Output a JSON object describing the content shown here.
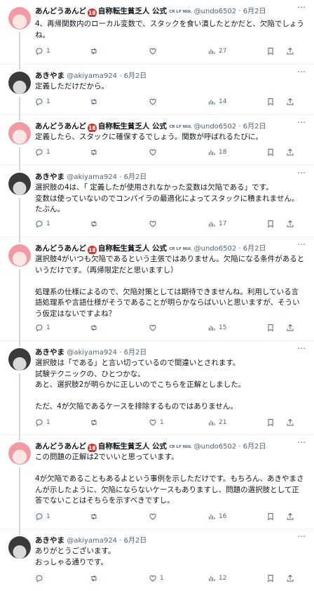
{
  "tweets": [
    {
      "avatar": "pink",
      "name": "あんどうあんど",
      "badge": "18",
      "name_suffix": "自称転生貧乏人 公式",
      "tiny_tag": "CR LF NUL",
      "handle_date": "@undo6502 · 6月2日",
      "text": "4、再帰関数内のローカル変数で、スタックを食い潰したとかだと、欠陥でしょうね。",
      "reply": "1",
      "retweet": "",
      "like": "",
      "views": "27"
    },
    {
      "avatar": "gray",
      "name": "あきやま",
      "name_suffix": "",
      "tiny_tag": "",
      "handle_date": "@akiyama924 · 6月2日",
      "text": "定義しただけだから。",
      "reply": "1",
      "retweet": "",
      "like": "",
      "views": "14"
    },
    {
      "avatar": "pink",
      "name": "あんどうあんど",
      "badge": "18",
      "name_suffix": "自称転生貧乏人 公式",
      "tiny_tag": "CR LF NUL",
      "handle_date": "@undo6502 · 6月2日",
      "text": "定義したら、スタックに確保するでしょう。関数が呼ばれるたびに。",
      "reply": "1",
      "retweet": "",
      "like": "",
      "views": "18"
    },
    {
      "avatar": "gray",
      "name": "あきやま",
      "name_suffix": "",
      "tiny_tag": "",
      "handle_date": "@akiyama924 · 6月2日",
      "text": "選択肢の4は、「 定義したが使用されなかった変数は欠陥である」です。\n変数は使っていないのでコンパイラの最適化によってスタックに積まれません。たぶん。",
      "reply": "1",
      "retweet": "",
      "like": "",
      "views": "17"
    },
    {
      "avatar": "pink",
      "name": "あんどうあんど",
      "badge": "18",
      "name_suffix": "自称転生貧乏人 公式",
      "tiny_tag": "CR LF NUL",
      "handle_date": "@undo6502 · 6月2日",
      "text": "選択肢4がいつも欠陥であるという主張ではありません。欠陥になる条件があるというだけです。（再帰限定だと思いますし）\n\n処理系の仕様によるので、欠陥対策としては期待できませんね。利用している言語処理系や言語仕様がそうであることが明らかならばいいと思いますが、そういう仮定はないですよね？",
      "reply": "1",
      "retweet": "",
      "like": "",
      "views": "15"
    },
    {
      "avatar": "gray",
      "name": "あきやま",
      "name_suffix": "",
      "tiny_tag": "",
      "handle_date": "@akiyama924 · 6月2日",
      "text": "選択肢は「である」と言い切っているので間違いとされます。\n試験テクニックの、ひとつかな。\nあと、選択肢2が明らかに正しいのでこちらを正解としました。\n\nただ、4が欠陥であるケースを排除するものではありません。",
      "reply": "1",
      "retweet": "",
      "like": "1",
      "views": "21"
    },
    {
      "avatar": "pink",
      "name": "あんどうあんど",
      "badge": "18",
      "name_suffix": "自称転生貧乏人 公式",
      "tiny_tag": "CR LF NUL",
      "handle_date": "@undo6502 · 6月2日",
      "text": "この問題の正解は2でいいと思っています。\n\n4が欠陥であることもあるよという事例を示しただけです。もちろん、あきやまさんが示したように、欠陥にならないケースもありますし、問題の選択肢として正答でないことはそちらを示すべきですし。",
      "reply": "1",
      "retweet": "",
      "like": "",
      "views": "16"
    },
    {
      "avatar": "gray",
      "name": "あきやま",
      "name_suffix": "",
      "tiny_tag": "",
      "handle_date": "@akiyama924 · 6月2日",
      "text": "ありがとうございます。\nおっしゃる通りです。",
      "reply": "",
      "retweet": "",
      "like": "1",
      "views": "12"
    }
  ],
  "colors": {
    "muted": "#536471",
    "text": "#0f1419",
    "line": "#cfd9de",
    "badge": "#d4352c"
  },
  "icons": [
    "more-icon",
    "reply-icon",
    "retweet-icon",
    "like-icon",
    "views-icon",
    "bookmark-icon",
    "share-icon"
  ]
}
